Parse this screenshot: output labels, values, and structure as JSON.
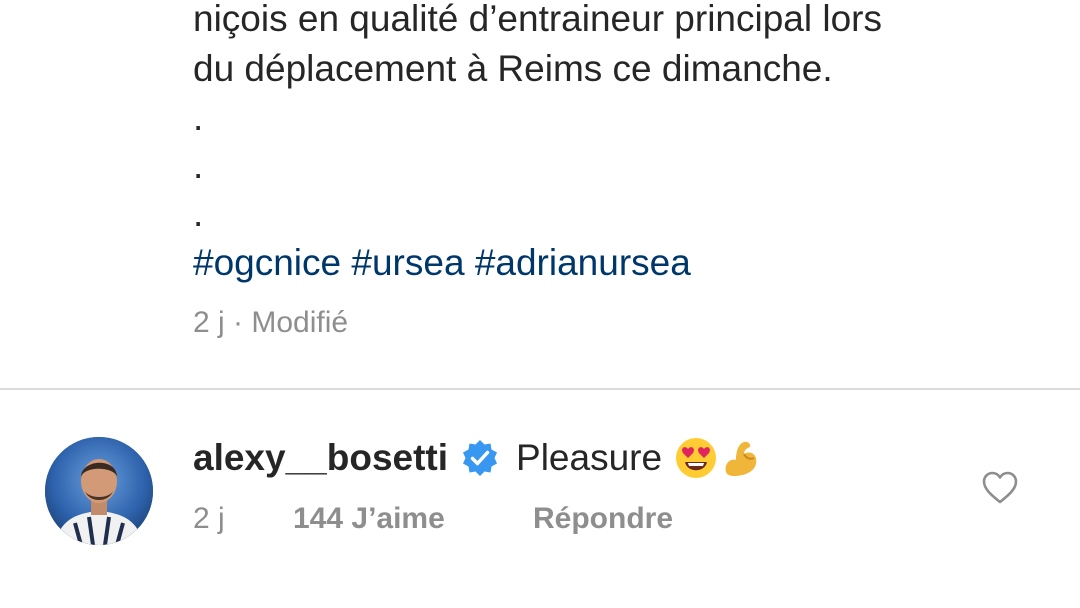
{
  "post": {
    "caption_lines": [
      "niçois en qualité d’entraineur principal lors",
      "du déplacement à Reims ce dimanche."
    ],
    "dots": [
      ".",
      ".",
      "."
    ],
    "hashtags": [
      "#ogcnice",
      "#ursea",
      "#adrianursea"
    ],
    "time": "2 j",
    "separator": "·",
    "edited_label": "Modifié"
  },
  "comment": {
    "username": "alexy__bosetti",
    "verified_icon": "verified-badge-icon",
    "text": "Pleasure",
    "emojis": [
      "heart-eyes-emoji",
      "flexed-biceps-emoji"
    ],
    "time": "2 j",
    "likes": "144 J’aime",
    "reply_label": "Répondre",
    "like_icon": "heart-outline-icon"
  },
  "colors": {
    "text": "#262626",
    "secondary": "#8e8e8e",
    "hashtag": "#00376b",
    "verified": "#3897f0",
    "divider": "#dbdbdb"
  }
}
